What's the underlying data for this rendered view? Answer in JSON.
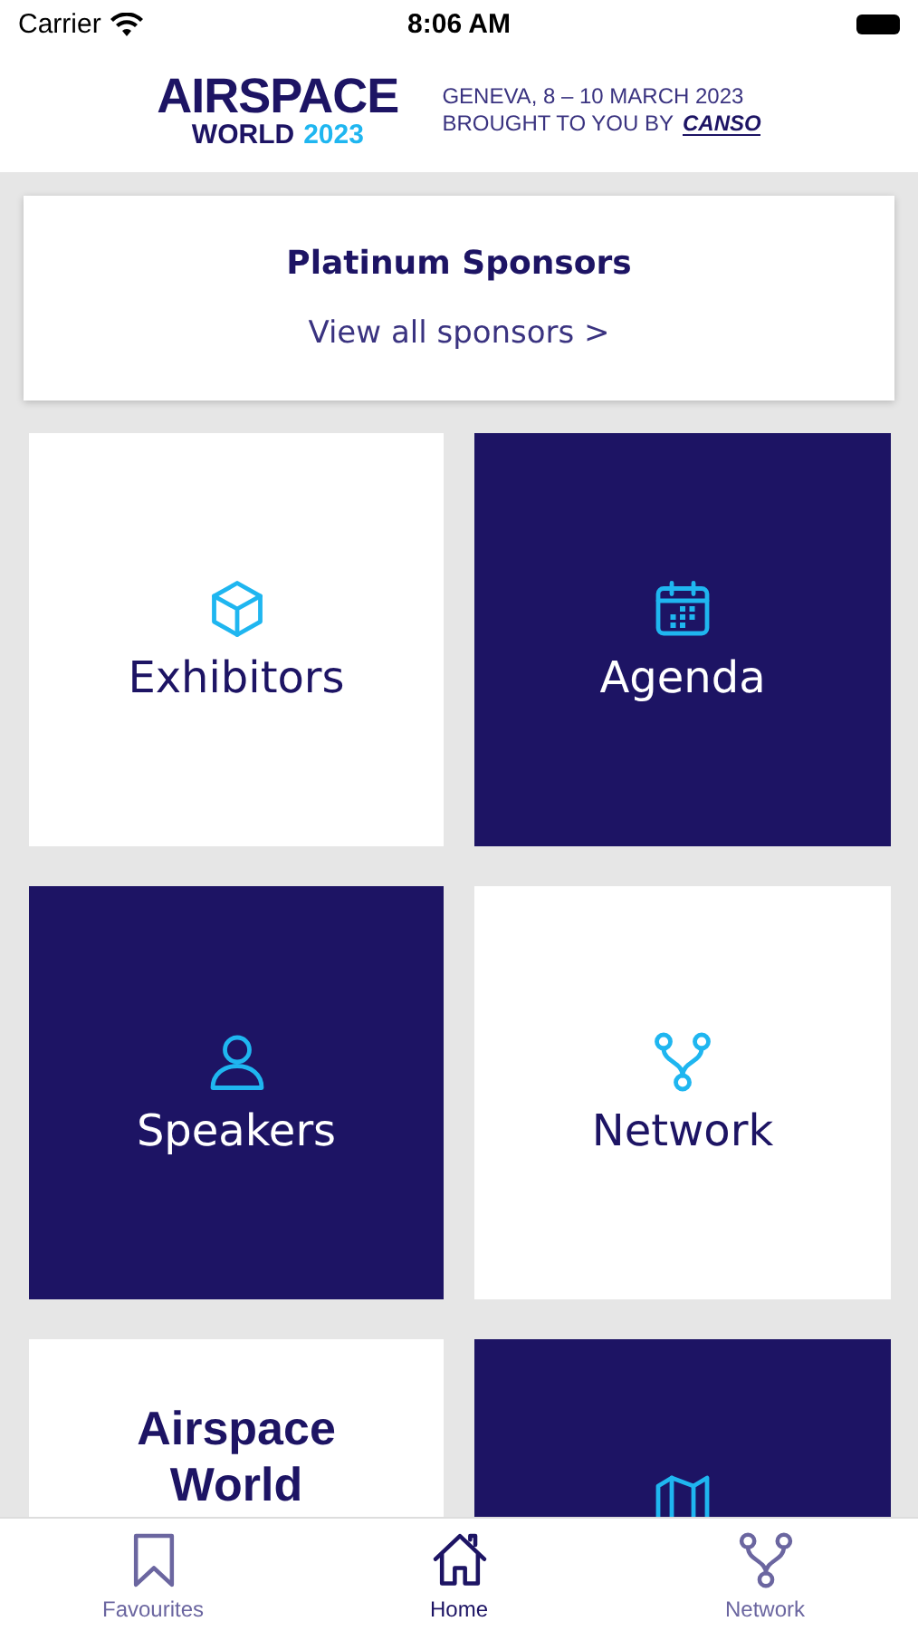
{
  "status_bar": {
    "carrier": "Carrier",
    "time": "8:06 AM"
  },
  "header": {
    "logo_top": "AIRSPACE",
    "logo_world": "WORLD",
    "logo_year": "2023",
    "event_line": "GENEVA, 8 – 10 MARCH 2023",
    "sponsor_line": "BROUGHT TO YOU BY",
    "sponsor_logo": "CANSO"
  },
  "sponsors": {
    "title": "Platinum Sponsors",
    "link": "View all sponsors >"
  },
  "tiles": [
    {
      "label": "Exhibitors",
      "kind": "light"
    },
    {
      "label": "Agenda",
      "kind": "dark"
    },
    {
      "label": "Speakers",
      "kind": "dark"
    },
    {
      "label": "Network",
      "kind": "light"
    },
    {
      "label": "Airspace World",
      "kind": "title"
    },
    {
      "kind": "dark"
    }
  ],
  "tab_bar": [
    {
      "label": "Favourites",
      "selected": false
    },
    {
      "label": "Home",
      "selected": true
    },
    {
      "label": "Network",
      "selected": false
    }
  ]
}
